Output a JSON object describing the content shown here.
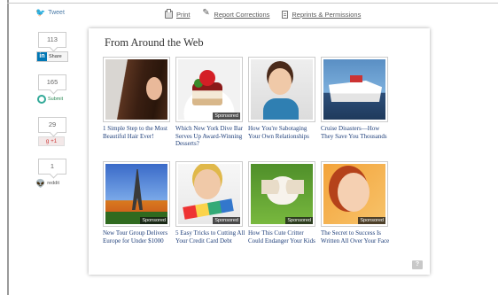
{
  "toolbar": {
    "tweet_label": "Tweet",
    "print_label": "Print",
    "corrections_label": "Report Corrections",
    "reprints_label": "Reprints & Permissions"
  },
  "share": {
    "linkedin": {
      "count": "113",
      "label": "Share"
    },
    "stumbleupon": {
      "count": "165",
      "label": "Submit"
    },
    "googleplus": {
      "count": "29",
      "label": "+1"
    },
    "reddit": {
      "count": "1",
      "label": "reddit"
    }
  },
  "widget": {
    "title": "From Around the Web",
    "items": [
      {
        "caption": "1 Simple Step to the Most Beautiful Hair Ever!",
        "badge": "",
        "image": "woman-hair-photo"
      },
      {
        "caption": "Which New York Dive Bar Serves Up Award-Winning Desserts?",
        "badge": "Sponsored",
        "image": "dessert-photo"
      },
      {
        "caption": "How You're Sabotaging Your Own Relationships",
        "badge": "",
        "image": "thinking-woman-photo"
      },
      {
        "caption": "Cruise Disasters—How They Save You Thousands",
        "badge": "",
        "image": "cruise-ship-photo"
      },
      {
        "caption": "New Tour Group Delivers Europe for Under $1000",
        "badge": "Sponsored",
        "image": "eiffel-tower-photo"
      },
      {
        "caption": "5 Easy Tricks to Cutting All Your Credit Card Debt",
        "badge": "Sponsored",
        "image": "credit-cards-photo"
      },
      {
        "caption": "How This Cute Critter Could Endanger Your Kids",
        "badge": "Sponsored",
        "image": "puppy-photo"
      },
      {
        "caption": "The Secret to Success Is Written All Over Your Face",
        "badge": "Sponsored",
        "image": "smiling-woman-photo"
      }
    ],
    "help_icon": "?"
  }
}
